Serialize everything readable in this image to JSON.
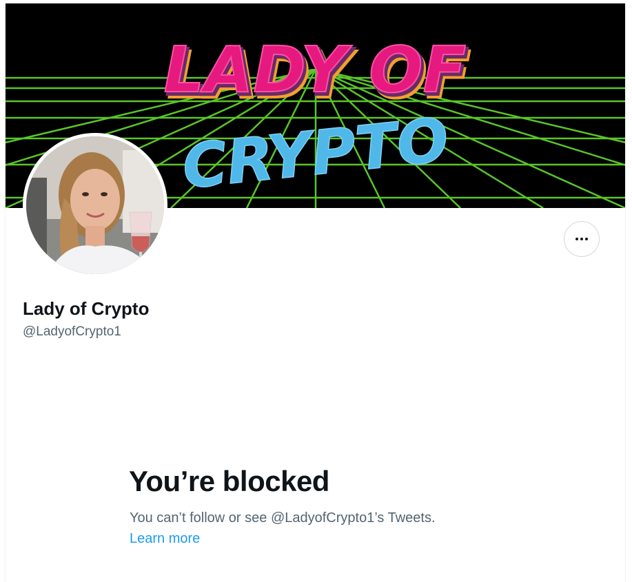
{
  "profile": {
    "banner_title_line1": "LADY OF",
    "banner_title_line2": "CRYPTO",
    "name": "Lady of Crypto",
    "handle": "@LadyofCrypto1"
  },
  "actions": {
    "more_icon": "ellipsis-icon"
  },
  "blocked": {
    "title": "You’re blocked",
    "message": "You can’t follow or see @LadyofCrypto1’s Tweets.",
    "learn_more": "Learn more"
  },
  "colors": {
    "banner_bg": "#000000",
    "grid": "#5fd12b",
    "title_pink": "#e5197e",
    "title_shadow": "#f0a030",
    "crypto_blue": "#4fb8e8",
    "link": "#1d9bf0",
    "text_primary": "#0f1419",
    "text_secondary": "#536471"
  }
}
